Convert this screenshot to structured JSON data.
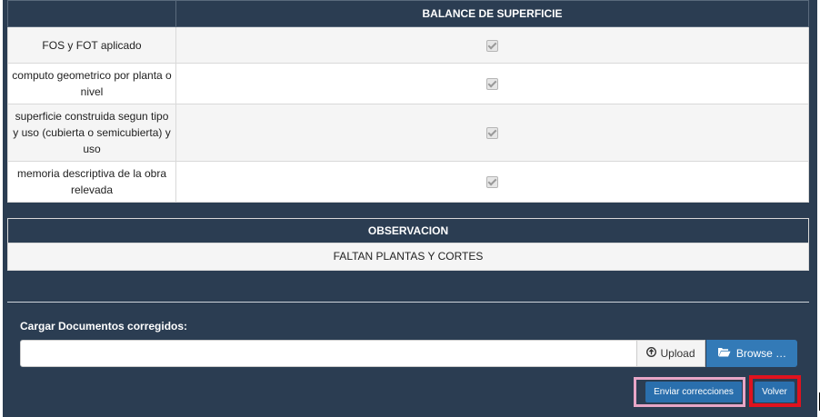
{
  "balance_table": {
    "header_left": "",
    "header_right": "BALANCE DE SUPERFICIE",
    "rows": [
      {
        "label": "FOS y FOT aplicado",
        "checked": true
      },
      {
        "label": "computo geometrico por planta o nivel",
        "checked": true
      },
      {
        "label": "superficie construida segun tipo y uso (cubierta o semicubierta) y uso",
        "checked": true
      },
      {
        "label": "memoria descriptiva de la obra relevada",
        "checked": true
      }
    ]
  },
  "observation": {
    "title": "OBSERVACION",
    "text": "FALTAN PLANTAS Y CORTES"
  },
  "upload": {
    "label": "Cargar Documentos corregidos:",
    "file_value": "",
    "upload_button": "Upload",
    "browse_button": "Browse …"
  },
  "actions": {
    "send_label": "Enviar correcciones",
    "back_label": "Volver"
  },
  "colors": {
    "panel": "#2b3d52",
    "primary_button": "#2a6fad",
    "highlight_pink": "#e7a6c7",
    "highlight_red": "#e0121e"
  }
}
